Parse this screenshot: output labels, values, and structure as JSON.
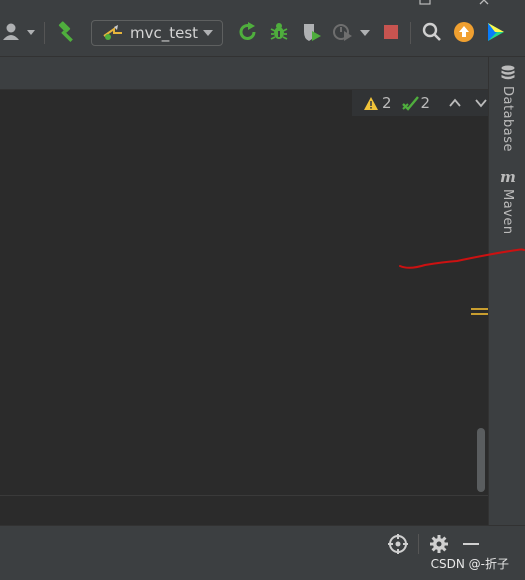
{
  "toolbar": {
    "run_config": {
      "label": "mvc_test"
    }
  },
  "inspection": {
    "warnings_count": "2",
    "weak_warnings_count": "2"
  },
  "right_sidebar": {
    "database_label": "Database",
    "maven_label": "Maven"
  },
  "watermark": "CSDN @-折子",
  "colors": {
    "background": "#2b2b2b",
    "panel": "#3c3f41",
    "accent_green": "#4fae3d",
    "stop_red": "#c75450",
    "warning_yellow": "#f0c339",
    "update_orange": "#f0a030",
    "annotation_red": "#cc1111"
  },
  "icons": [
    "user-icon",
    "build-hammer-icon",
    "rerun-icon",
    "debug-icon",
    "coverage-icon",
    "profiler-icon",
    "stop-icon",
    "search-icon",
    "update-icon",
    "plugin-icon",
    "database-icon",
    "maven-icon",
    "warning-icon",
    "check-icon",
    "chevron-up-icon",
    "chevron-down-icon",
    "target-icon",
    "gear-icon",
    "minimize-icon"
  ]
}
